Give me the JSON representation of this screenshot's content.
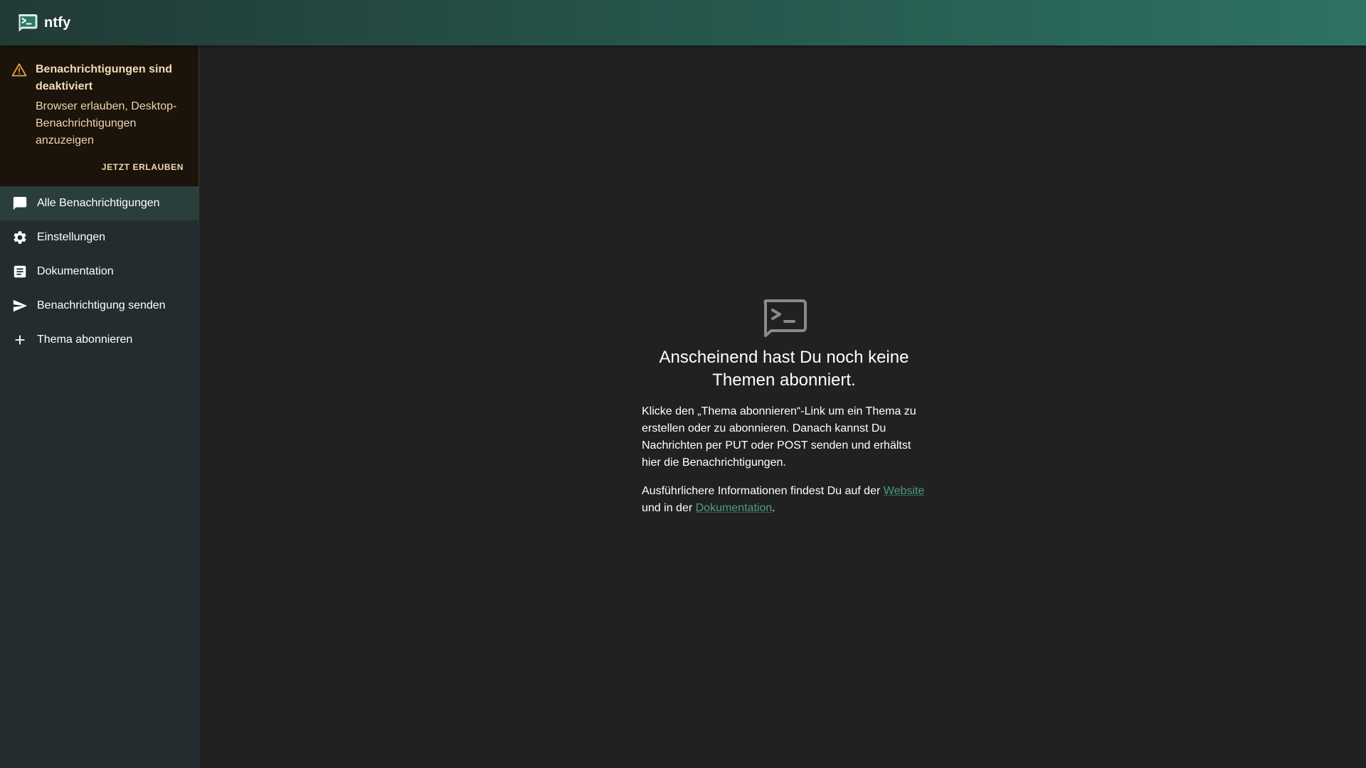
{
  "appbar": {
    "title": "ntfy",
    "logo_icon": "terminal-message-icon"
  },
  "colors": {
    "appbar_gradient": [
      "#223a36",
      "#2f7264"
    ],
    "sidebar_bg": "#242c30",
    "main_bg": "#212121",
    "alert_bg": "#1a140b",
    "alert_text": "#f0d5ad",
    "warning_icon": "#e5a14b",
    "link": "#4c9c88",
    "selected_item_bg": "#2a3e3c"
  },
  "alert": {
    "icon": "warning-icon",
    "title": "Benachrichtigungen sind deaktiviert",
    "text": "Browser erlauben, Desktop-Benachrichtigungen anzuzeigen",
    "action_label": "JETZT ERLAUBEN"
  },
  "nav": {
    "items": [
      {
        "label": "Alle Benachrichtigungen",
        "icon": "chat-icon",
        "selected": true
      },
      {
        "label": "Einstellungen",
        "icon": "gear-icon",
        "selected": false
      },
      {
        "label": "Dokumentation",
        "icon": "article-icon",
        "selected": false
      },
      {
        "label": "Benachrichtigung senden",
        "icon": "send-icon",
        "selected": false
      },
      {
        "label": "Thema abonnieren",
        "icon": "plus-icon",
        "selected": false
      }
    ]
  },
  "empty_state": {
    "icon": "terminal-message-icon",
    "title": "Anscheinend hast Du noch keine Themen abonniert.",
    "paragraph1": "Klicke den „Thema abonnieren“-Link um ein Thema zu erstellen oder zu abonnieren. Danach kannst Du Nachrichten per PUT oder POST senden und erhältst hier die Benachrichtigungen.",
    "paragraph2_prefix": "Ausführlichere Informationen findest Du auf der",
    "website_link": "Website",
    "paragraph2_middle": "und in der",
    "docs_link": "Dokumentation",
    "paragraph2_suffix": "."
  }
}
